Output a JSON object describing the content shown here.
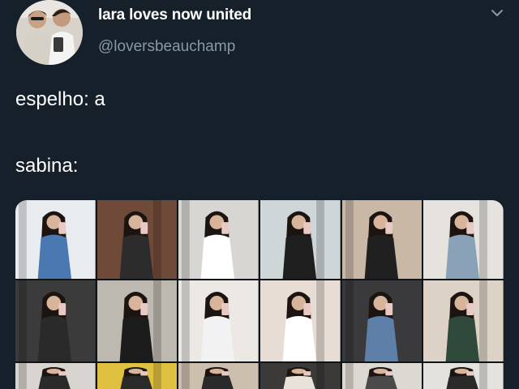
{
  "tweet": {
    "author": {
      "display_name": "lara loves now united",
      "handle": "@loversbeauchamp",
      "avatar_icon": "avatar-photo"
    },
    "menu_icon": "chevron-down-icon",
    "lines": [
      "espelho: a",
      "sabina:"
    ]
  },
  "media": {
    "type": "photo-collage",
    "columns": 6,
    "rows": 3,
    "cells": [
      {
        "bg": "#e9ecef",
        "accent": "#4a78b0"
      },
      {
        "bg": "#6f4a38",
        "accent": "#2c2c2c"
      },
      {
        "bg": "#d8d6d2",
        "accent": "#ffffff"
      },
      {
        "bg": "#cfd6d8",
        "accent": "#1e1e1e"
      },
      {
        "bg": "#c9b8a6",
        "accent": "#202020"
      },
      {
        "bg": "#e6e3de",
        "accent": "#8aa2b8"
      },
      {
        "bg": "#3b3b3b",
        "accent": "#2a2a2a"
      },
      {
        "bg": "#bdb8b0",
        "accent": "#1c1c1c"
      },
      {
        "bg": "#ece9e4",
        "accent": "#f2f2f2"
      },
      {
        "bg": "#e7ddd5",
        "accent": "#ffffff"
      },
      {
        "bg": "#3a3a3c",
        "accent": "#5d7fa8"
      },
      {
        "bg": "#ddd2c6",
        "accent": "#2f4a3a"
      },
      {
        "bg": "#d8d4cf",
        "accent": "#2a2a2a"
      },
      {
        "bg": "#e0c040",
        "accent": "#2a2a2a"
      },
      {
        "bg": "#cdbfae",
        "accent": "#2a2a2a"
      },
      {
        "bg": "#3c3a38",
        "accent": "#e8e2da"
      },
      {
        "bg": "#dcd8d2",
        "accent": "#4a4a4a"
      },
      {
        "bg": "#e4e2de",
        "accent": "#2a2a2a"
      }
    ]
  }
}
